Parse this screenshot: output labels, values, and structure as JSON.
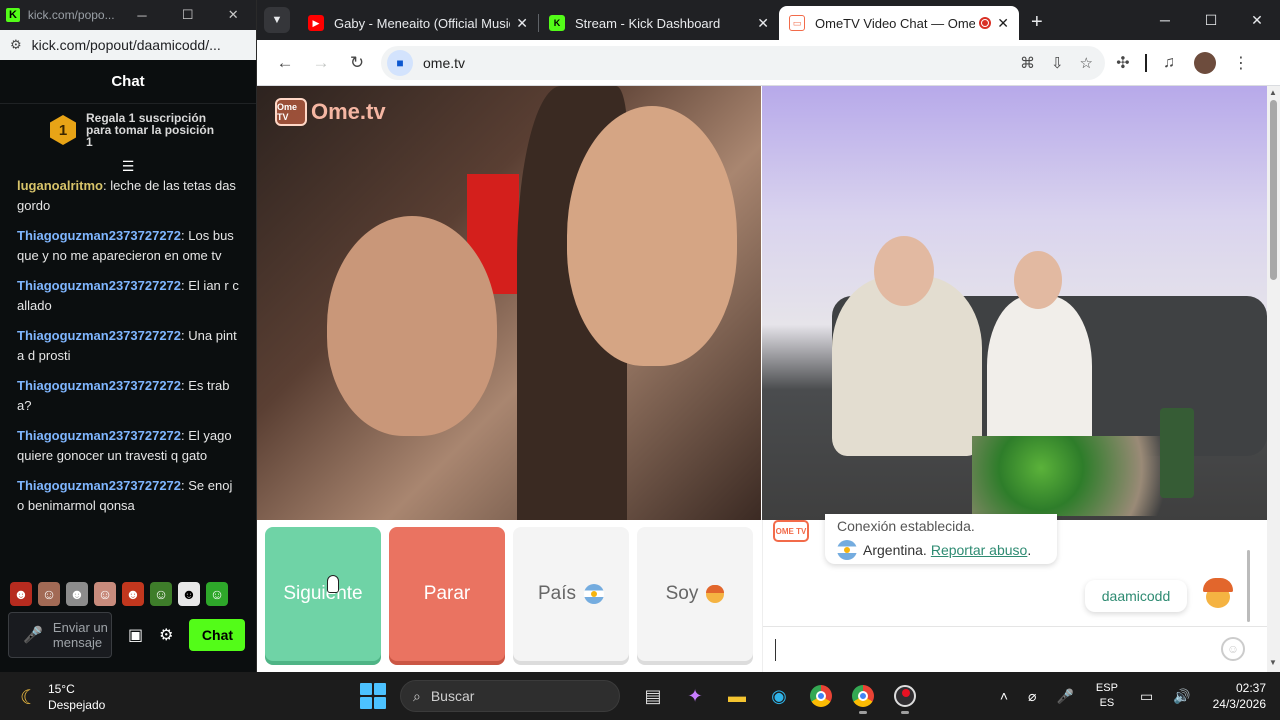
{
  "popout": {
    "title": "kick.com/popo...",
    "url": "kick.com/popout/daamicodd/...",
    "chat_header": "Chat",
    "promo": {
      "rank": "1",
      "text": "Regala 1 suscripción para tomar la posición 1"
    },
    "messages": [
      {
        "user": "luganoalritmo",
        "color": "#d8c46a",
        "text": "leche de las tetas das gordo"
      },
      {
        "user": "Thiagoguzman2373727272",
        "color": "#7fb6ff",
        "text": "Los busque y no me aparecieron en ome tv"
      },
      {
        "user": "Thiagoguzman2373727272",
        "color": "#7fb6ff",
        "text": "El ian r callado"
      },
      {
        "user": "Thiagoguzman2373727272",
        "color": "#7fb6ff",
        "text": "Una pinta d prosti"
      },
      {
        "user": "Thiagoguzman2373727272",
        "color": "#7fb6ff",
        "text": "Es traba?"
      },
      {
        "user": "Thiagoguzman2373727272",
        "color": "#7fb6ff",
        "text": "El yago quiere gonocer un travesti q gato"
      },
      {
        "user": "Thiagoguzman2373727272",
        "color": "#7fb6ff",
        "text": "Se enojo benimarmol qonsa"
      }
    ],
    "input_placeholder": "Enviar un mensaje",
    "send_label": "Chat"
  },
  "browser": {
    "tabs": [
      {
        "label": "Gaby - Meneaito (Official Music",
        "icon": "youtube-icon"
      },
      {
        "label": "Stream - Kick Dashboard",
        "icon": "kick-icon"
      },
      {
        "label": "OmeTV Video Chat — Ome",
        "icon": "ometv-icon",
        "active": true
      }
    ],
    "url": "ome.tv"
  },
  "ometv": {
    "logo_box": "Ome TV",
    "logo_text": "Ome.tv",
    "next_label": "Siguiente",
    "stop_label": "Parar",
    "country_label": "País",
    "gender_label": "Soy",
    "system_message": "Conexión establecida.",
    "country_name": "Argentina.",
    "report_link": "Reportar abuso",
    "report_suffix": ".",
    "username": "daamicodd",
    "avatar_label": "OME TV"
  },
  "taskbar": {
    "temperature": "15°C",
    "weather": "Despejado",
    "search_placeholder": "Buscar",
    "lang_line1": "ESP",
    "lang_line2": "ES",
    "time": "02:37",
    "date": "24/3/2026"
  },
  "colors": {
    "kick_green": "#53fc18",
    "ome_green": "#6fd3a6",
    "ome_red": "#ea7361",
    "link_green": "#2e8b72"
  }
}
